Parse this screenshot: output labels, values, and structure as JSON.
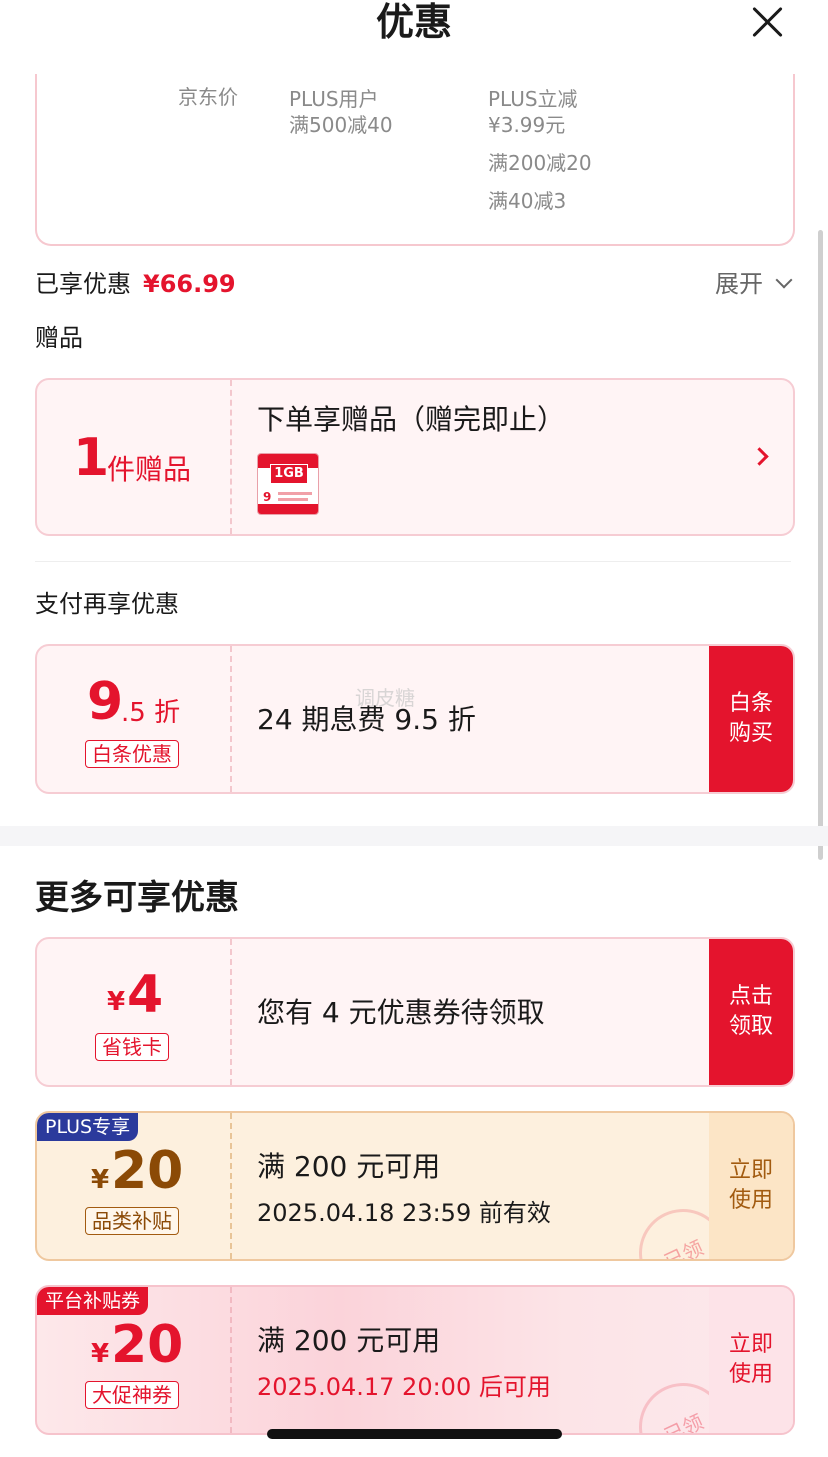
{
  "header": {
    "title": "优惠",
    "close_icon": "close-icon"
  },
  "price_table": {
    "jd_price_label": "京东价",
    "plus_user_label": "PLUS用户",
    "plus_user_offer": "满500减40",
    "plus_discount_label": "PLUS立减",
    "plus_discount_value": "¥3.99元",
    "offer_2": "满200减20",
    "offer_3": "满40减3"
  },
  "summary": {
    "label": "已享优惠",
    "amount": "¥66.99",
    "expand_label": "展开"
  },
  "gift": {
    "section_label": "赠品",
    "count": "1",
    "count_unit": "件赠品",
    "title": "下单享赠品（赠完即止）",
    "image_label": "1GB"
  },
  "payment": {
    "section_label": "支付再享优惠",
    "discount_main": "9",
    "discount_sub": ".5 折",
    "tag": "白条优惠",
    "title": "24 期息费 9.5 折",
    "watermark": "调皮糖",
    "button": "白条购买"
  },
  "more": {
    "title": "更多可享优惠",
    "coupons": [
      {
        "currency": "¥",
        "amount": "4",
        "tag": "省钱卡",
        "title": "您有 4 元优惠券待领取",
        "button": "点击领取"
      },
      {
        "ribbon": "PLUS专享",
        "currency": "¥",
        "amount": "20",
        "tag": "品类补贴",
        "title": "满 200 元可用",
        "subtitle": "2025.04.18 23:59 前有效",
        "button": "立即使用",
        "stamp": "已领"
      },
      {
        "ribbon": "平台补贴券",
        "currency": "¥",
        "amount": "20",
        "tag": "大促神券",
        "title": "满 200 元可用",
        "subtitle": "2025.04.17 20:00 后可用",
        "button": "立即使用",
        "stamp": "已领"
      }
    ]
  },
  "colors": {
    "accent": "#e4142d",
    "gold_text": "#8b4a06",
    "pink_bg": "#fff4f5"
  }
}
